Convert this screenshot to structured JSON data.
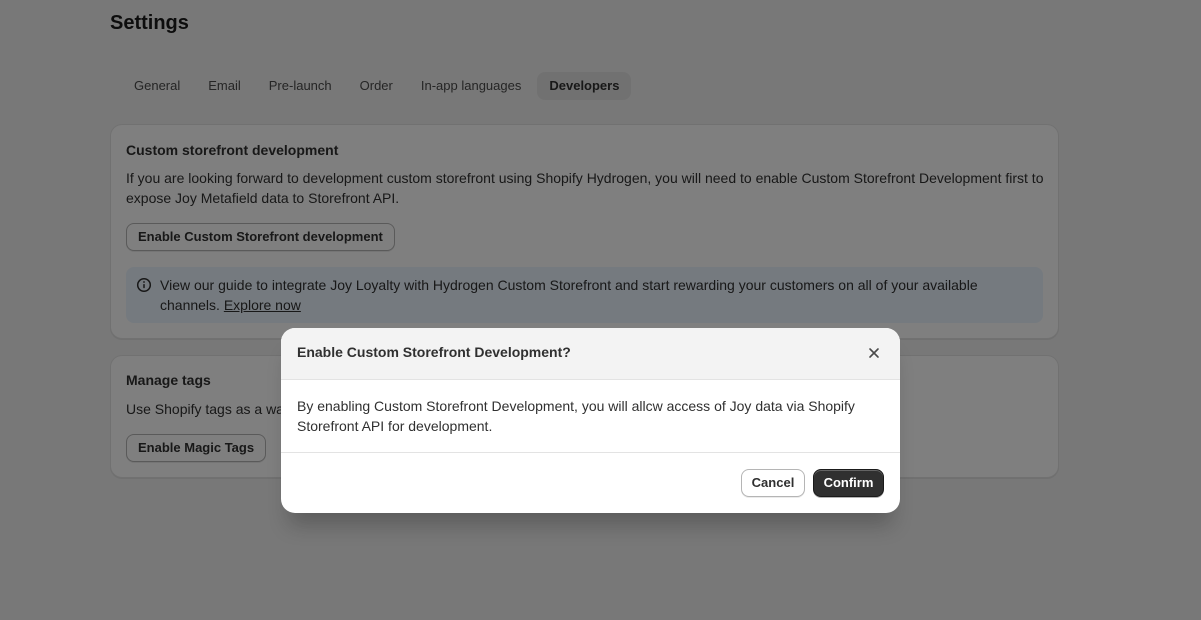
{
  "page": {
    "title": "Settings"
  },
  "tabs": [
    {
      "label": "General",
      "active": false
    },
    {
      "label": "Email",
      "active": false
    },
    {
      "label": "Pre-launch",
      "active": false
    },
    {
      "label": "Order",
      "active": false
    },
    {
      "label": "In-app languages",
      "active": false
    },
    {
      "label": "Developers",
      "active": true
    }
  ],
  "custom_storefront": {
    "title": "Custom storefront development",
    "description": "If you are looking forward to development custom storefront using Shopify Hydrogen, you will need to enable Custom Storefront Development first to expose Joy Metafield data to Storefront API.",
    "button_label": "Enable Custom Storefront development",
    "banner": {
      "icon": "info-icon",
      "text": "View our guide to integrate Joy Loyalty with Hydrogen Custom Storefront and start rewarding your customers on all of your available channels.",
      "link_label": "Explore now"
    }
  },
  "manage_tags": {
    "title": "Manage tags",
    "description": "Use Shopify tags as a wa",
    "button_label": "Enable Magic Tags"
  },
  "modal": {
    "title": "Enable Custom Storefront Development?",
    "close_icon": "close-icon",
    "body": "By enabling Custom Storefront Development, you will allcw access of Joy data via Shopify Storefront API for development.",
    "cancel_label": "Cancel",
    "confirm_label": "Confirm"
  },
  "colors": {
    "page_bg": "#f1f1f1",
    "overlay": "rgba(0,0,0,0.5)",
    "primary_button": "#303030",
    "banner_bg": "#eaf4ff"
  }
}
